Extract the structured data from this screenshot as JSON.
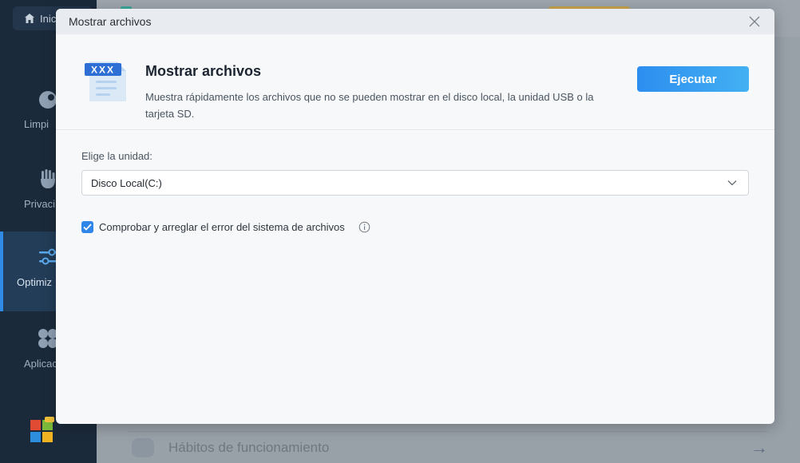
{
  "sidebar": {
    "home_label": "Inici",
    "items": [
      {
        "label": "Limpi",
        "icon": "broom-icon"
      },
      {
        "label": "Privaci",
        "icon": "hand-icon"
      },
      {
        "label": "Optimiz",
        "icon": "sliders-icon"
      },
      {
        "label": "Aplicac",
        "icon": "apps-icon"
      }
    ],
    "active_index": 2
  },
  "background_row": {
    "label": "Hábitos de funcionamiento"
  },
  "dialog": {
    "window_title": "Mostrar archivos",
    "feature_title": "Mostrar archivos",
    "feature_description": "Muestra rápidamente los archivos que no se pueden mostrar en el disco local, la unidad USB o la tarjeta SD.",
    "icon_text": "XXX",
    "run_button_label": "Ejecutar",
    "drive_label": "Elige la unidad:",
    "drive_selected": "Disco Local(C:)",
    "checkbox_label": "Comprobar y arreglar el error del sistema de archivos",
    "checkbox_checked": true
  },
  "colors": {
    "accent": "#2f86e8",
    "sidebar_bg": "#1b2a3b",
    "dialog_bg": "#f6f8fa",
    "titlebar_bg": "#e8ecf0"
  }
}
